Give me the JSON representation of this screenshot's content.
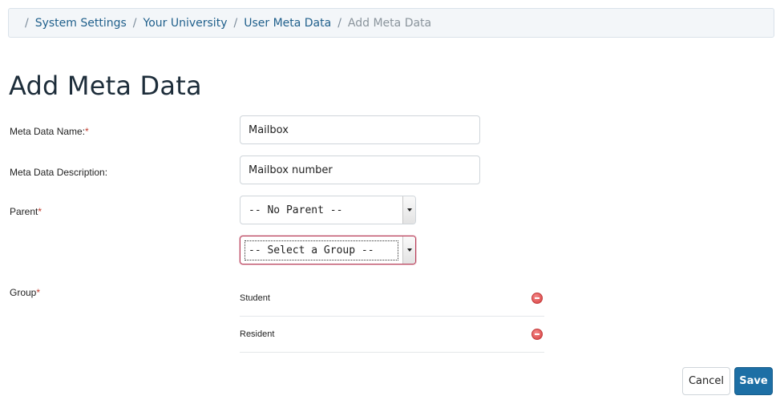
{
  "breadcrumb": {
    "items": [
      {
        "label": "System Settings"
      },
      {
        "label": "Your University"
      },
      {
        "label": "User Meta Data"
      }
    ],
    "current": "Add Meta Data"
  },
  "page_title": "Add Meta Data",
  "form": {
    "name": {
      "label": "Meta Data Name:",
      "required_mark": "*",
      "value": "Mailbox"
    },
    "description": {
      "label": "Meta Data Description:",
      "value": "Mailbox number"
    },
    "parent": {
      "label": "Parent",
      "required_mark": "*",
      "selected": "-- No Parent --"
    },
    "group_select": {
      "selected": "-- Select a Group --"
    },
    "group": {
      "label": "Group",
      "required_mark": "*",
      "items": [
        {
          "label": "Student"
        },
        {
          "label": "Resident"
        }
      ]
    }
  },
  "actions": {
    "cancel_label": "Cancel",
    "save_label": "Save"
  },
  "colors": {
    "link": "#1f5f8b",
    "primary_button": "#1d6fa5",
    "required": "#c0392b",
    "remove_icon": "#d63f3f"
  }
}
